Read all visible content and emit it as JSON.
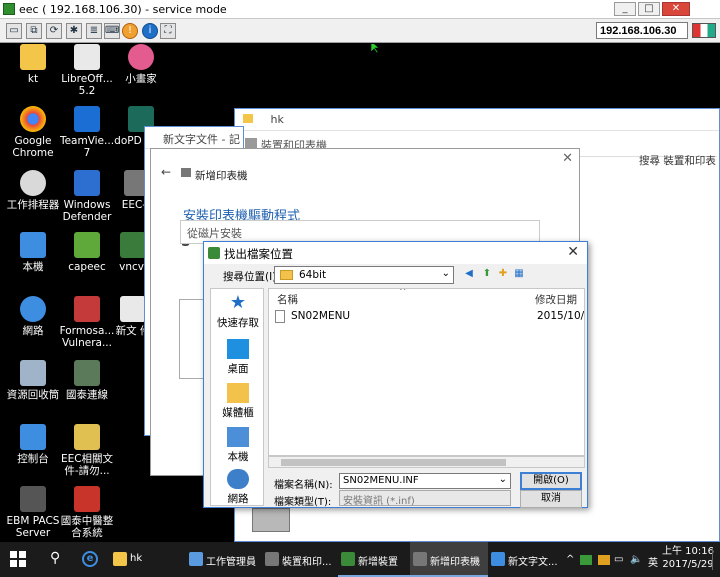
{
  "vnc": {
    "title": "eec ( 192.168.106.30) - service mode",
    "address": "192.168.106.30",
    "window_buttons": {
      "minimize": "_",
      "maximize": "□",
      "close": "✕"
    }
  },
  "desktop_icons": [
    {
      "label": "kt",
      "color": "#f3c64a"
    },
    {
      "label": "LibreOff... 5.2",
      "color": "#e9e9e9"
    },
    {
      "label": "小畫家",
      "color": "#e35b8f"
    },
    {
      "label": "Google Chrome",
      "color": "#e8453c"
    },
    {
      "label": "TeamVie... 7",
      "color": "#1b6ed4"
    },
    {
      "label": "doPD Gett",
      "color": "#1c6a5a"
    },
    {
      "label": "工作排程器",
      "color": "#d9d9d9"
    },
    {
      "label": "Windows Defender",
      "color": "#2d6fd0"
    },
    {
      "label": "EEC-F",
      "color": "#777777"
    },
    {
      "label": "本機",
      "color": "#3d8ee0"
    },
    {
      "label": "capeec",
      "color": "#5fa83a"
    },
    {
      "label": "vncvi",
      "color": "#3a7a3a"
    },
    {
      "label": "網路",
      "color": "#3d8ee0"
    },
    {
      "label": "Formosa... Vulnera...",
      "color": "#c43a3a"
    },
    {
      "label": "新文 件",
      "color": "#e9e9e9"
    },
    {
      "label": "資源回收筒",
      "color": "#9fb4c8"
    },
    {
      "label": "國泰連線",
      "color": "#5a7a5a"
    },
    {
      "label": "控制台",
      "color": "#3d8ee0"
    },
    {
      "label": "EEC相關文件-請勿...",
      "color": "#e0c050"
    },
    {
      "label": "EBM PACS Server",
      "color": "#3a3a3a"
    },
    {
      "label": "國泰中醫整合系統",
      "color": "#c8332a"
    }
  ],
  "bg_windows": {
    "hk": "hk",
    "notepad": "新文字文件 - 記",
    "devices": "裝置和印表機",
    "devices_search": "搜尋 裝置和印表"
  },
  "wizard": {
    "header": "新增印表機",
    "title": "安裝印表機驅動程式",
    "disk_dialog": "從磁片安裝"
  },
  "file_dialog": {
    "title": "找出檔案位置",
    "lookin_label": "搜尋位置(I):",
    "lookin_value": "64bit",
    "places": [
      "快速存取",
      "桌面",
      "媒體櫃",
      "本機",
      "網路"
    ],
    "columns": {
      "name": "名稱",
      "date": "修改日期"
    },
    "files": [
      {
        "name": "SN02MENU",
        "date": "2015/10/2"
      }
    ],
    "filename_label": "檔案名稱(N):",
    "filename_value": "SN02MENU.INF",
    "filetype_label": "檔案類型(T):",
    "filetype_value": "安裝資訊 (*.inf)",
    "open_button": "開啟(O)",
    "cancel_button": "取消"
  },
  "taskbar": {
    "items": [
      {
        "label": "hk",
        "color": "#f3c64a"
      },
      {
        "label": "工作管理員",
        "color": "#5a9be0"
      },
      {
        "label": "裝置和印...",
        "color": "#777777"
      },
      {
        "label": "新增裝置",
        "color": "#3a8a3a"
      },
      {
        "label": "新增印表機",
        "color": "#777777"
      },
      {
        "label": "新文字文...",
        "color": "#3d8ee0"
      }
    ],
    "ime": "英",
    "time": "上午 10:16",
    "date": "2017/5/29"
  }
}
